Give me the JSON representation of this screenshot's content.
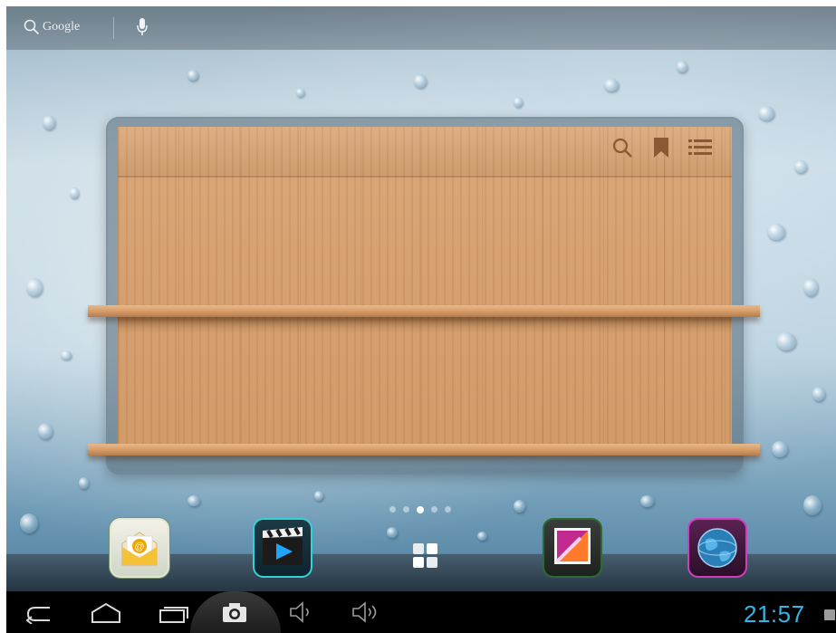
{
  "search_bar": {
    "label": "Google",
    "icons": [
      "search-icon",
      "mic-icon"
    ]
  },
  "bookshelf_widget": {
    "header_icons": [
      "search-icon",
      "bookmark-icon",
      "list-icon"
    ]
  },
  "page_indicator": {
    "count": 5,
    "active_index": 2
  },
  "dock": {
    "apps": [
      {
        "name": "email",
        "icon": "email-app-icon"
      },
      {
        "name": "video",
        "icon": "video-player-app-icon"
      },
      {
        "name": "app-drawer",
        "icon": "app-drawer-icon"
      },
      {
        "name": "gallery",
        "icon": "gallery-app-icon"
      },
      {
        "name": "browser",
        "icon": "browser-app-icon"
      }
    ]
  },
  "nav_bar": {
    "buttons": [
      "back-icon",
      "home-icon",
      "recent-apps-icon",
      "screenshot-camera-icon",
      "volume-down-icon",
      "volume-up-icon"
    ],
    "clock": "21:57",
    "accent_color": "#33b5e5"
  }
}
